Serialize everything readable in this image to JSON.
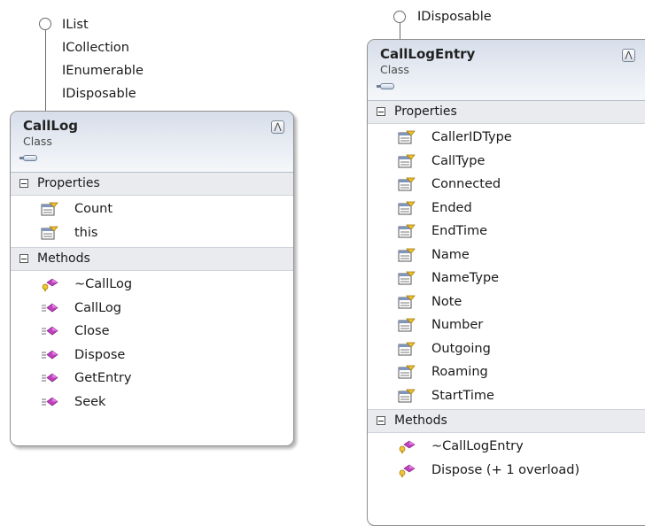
{
  "diagram": {
    "left_class": {
      "interfaces": [
        "IList",
        "ICollection",
        "IEnumerable",
        "IDisposable"
      ],
      "name": "CallLog",
      "kind": "Class",
      "collapse_glyph": "⋀",
      "properties_label": "Properties",
      "properties": [
        "Count",
        "this"
      ],
      "methods_label": "Methods",
      "methods": [
        {
          "name": "~CallLog",
          "icon": "protected-method-icon"
        },
        {
          "name": "CallLog",
          "icon": "public-method-icon"
        },
        {
          "name": "Close",
          "icon": "public-method-icon"
        },
        {
          "name": "Dispose",
          "icon": "public-method-icon"
        },
        {
          "name": "GetEntry",
          "icon": "public-method-icon"
        },
        {
          "name": "Seek",
          "icon": "public-method-icon"
        }
      ]
    },
    "right_class": {
      "interfaces": [
        "IDisposable"
      ],
      "name": "CallLogEntry",
      "kind": "Class",
      "collapse_glyph": "⋀",
      "properties_label": "Properties",
      "properties": [
        "CallerIDType",
        "CallType",
        "Connected",
        "Ended",
        "EndTime",
        "Name",
        "NameType",
        "Note",
        "Number",
        "Outgoing",
        "Roaming",
        "StartTime"
      ],
      "methods_label": "Methods",
      "methods": [
        {
          "name": "~CallLogEntry",
          "icon": "protected-method-icon"
        },
        {
          "name": "Dispose (+ 1 overload)",
          "icon": "protected-method-icon"
        }
      ]
    }
  }
}
